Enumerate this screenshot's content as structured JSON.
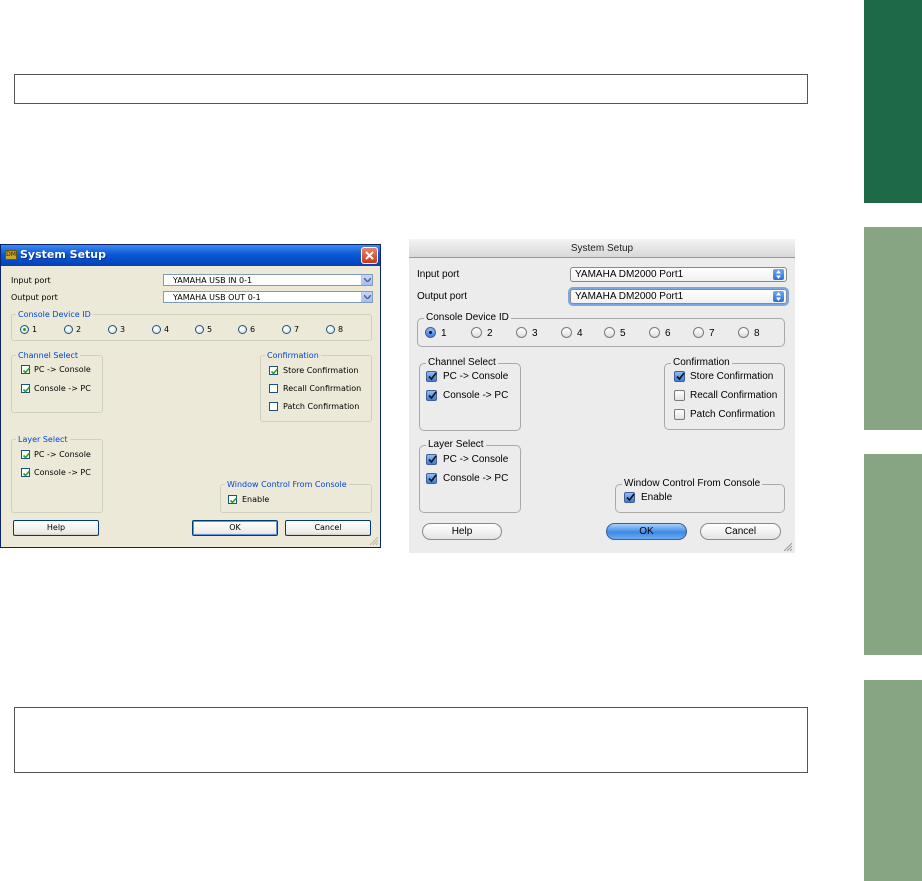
{
  "colors": {
    "tab_active": "#1f6a46",
    "tab_inactive": "#87a583",
    "xp_title_blue": "#0a58d6",
    "xp_group_text": "#0046d5",
    "mac_default_button": "#3d8ae6"
  },
  "windows_dialog": {
    "title": "System Setup",
    "app_icon_text": "DM",
    "input_port_label": "Input port",
    "input_port_value": "YAMAHA USB IN 0-1",
    "output_port_label": "Output port",
    "output_port_value": "YAMAHA USB OUT 0-1",
    "console_device_id_label": "Console Device ID",
    "device_ids": [
      "1",
      "2",
      "3",
      "4",
      "5",
      "6",
      "7",
      "8"
    ],
    "selected_device_id": "1",
    "channel_select": {
      "label": "Channel Select",
      "items": [
        {
          "label": "PC -> Console",
          "checked": true
        },
        {
          "label": "Console -> PC",
          "checked": true
        }
      ]
    },
    "confirmation": {
      "label": "Confirmation",
      "items": [
        {
          "label": "Store Confirmation",
          "checked": true
        },
        {
          "label": "Recall Confirmation",
          "checked": false
        },
        {
          "label": "Patch Confirmation",
          "checked": false
        }
      ]
    },
    "layer_select": {
      "label": "Layer Select",
      "items": [
        {
          "label": "PC -> Console",
          "checked": true
        },
        {
          "label": "Console -> PC",
          "checked": true
        }
      ]
    },
    "window_control": {
      "label": "Window Control From Console",
      "enable_label": "Enable",
      "enabled": true
    },
    "help_button": "Help",
    "ok_button": "OK",
    "cancel_button": "Cancel"
  },
  "mac_dialog": {
    "title": "System Setup",
    "input_port_label": "Input port",
    "input_port_value": "YAMAHA DM2000 Port1",
    "output_port_label": "Output port",
    "output_port_value": "YAMAHA DM2000 Port1",
    "console_device_id_label": "Console Device ID",
    "device_ids": [
      "1",
      "2",
      "3",
      "4",
      "5",
      "6",
      "7",
      "8"
    ],
    "selected_device_id": "1",
    "channel_select": {
      "label": "Channel Select",
      "items": [
        {
          "label": "PC -> Console",
          "checked": true
        },
        {
          "label": "Console -> PC",
          "checked": true
        }
      ]
    },
    "confirmation": {
      "label": "Confirmation",
      "items": [
        {
          "label": "Store Confirmation",
          "checked": true
        },
        {
          "label": "Recall Confirmation",
          "checked": false
        },
        {
          "label": "Patch Confirmation",
          "checked": false
        }
      ]
    },
    "layer_select": {
      "label": "Layer Select",
      "items": [
        {
          "label": "PC -> Console",
          "checked": true
        },
        {
          "label": "Console -> PC",
          "checked": true
        }
      ]
    },
    "window_control": {
      "label": "Window Control From Console",
      "enable_label": "Enable",
      "enabled": true
    },
    "help_button": "Help",
    "ok_button": "OK",
    "cancel_button": "Cancel"
  }
}
